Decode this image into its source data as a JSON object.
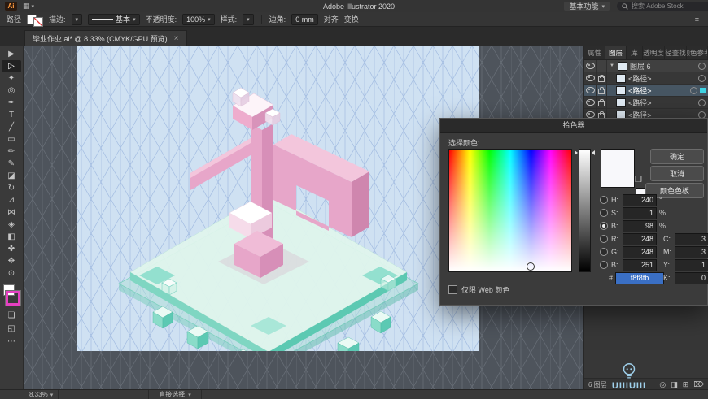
{
  "titlebar": {
    "logo": "Ai",
    "arrange_icon": "▦",
    "title": "Adobe Illustrator 2020",
    "workspace": "基本功能",
    "search_placeholder": "搜索 Adobe Stock",
    "caret": "▾"
  },
  "controlbar": {
    "context": "路径",
    "stroke": "描边:",
    "brush": "基本",
    "opacity": "不透明度:",
    "opacity_value": "100%",
    "style": "样式:",
    "corner": "边角:",
    "corner_value": "0 mm",
    "align": "对齐",
    "transform": "变换",
    "menu_icon": "≡",
    "more_icon": "⋯",
    "caret": "▾"
  },
  "doc_tab": {
    "title": "毕业作业.ai* @ 8.33% (CMYK/GPU 预览)",
    "close": "×"
  },
  "tools": [
    {
      "name": "selection-tool",
      "glyph": "▶"
    },
    {
      "name": "direct-selection-tool",
      "glyph": "▷",
      "active": true
    },
    {
      "name": "magic-wand-tool",
      "glyph": "✦"
    },
    {
      "name": "lasso-tool",
      "glyph": "◎"
    },
    {
      "name": "pen-tool",
      "glyph": "✒"
    },
    {
      "name": "type-tool",
      "glyph": "T"
    },
    {
      "name": "line-segment-tool",
      "glyph": "╱"
    },
    {
      "name": "rectangle-tool",
      "glyph": "▭"
    },
    {
      "name": "paintbrush-tool",
      "glyph": "✏"
    },
    {
      "name": "pencil-tool",
      "glyph": "✎"
    },
    {
      "name": "eraser-tool",
      "glyph": "◪"
    },
    {
      "name": "rotate-tool",
      "glyph": "↻"
    },
    {
      "name": "scale-tool",
      "glyph": "⊿"
    },
    {
      "name": "width-tool",
      "glyph": "⋈"
    },
    {
      "name": "shape-builder-tool",
      "glyph": "◈"
    },
    {
      "name": "gradient-tool",
      "glyph": "◧"
    },
    {
      "name": "eyedropper-tool",
      "glyph": "✤"
    },
    {
      "name": "hand-tool",
      "glyph": "✥"
    },
    {
      "name": "zoom-tool",
      "glyph": "⊙"
    }
  ],
  "toolbar_bottom": [
    {
      "name": "draw-mode-icon",
      "glyph": "❏"
    },
    {
      "name": "screen-mode-icon",
      "glyph": "◱"
    },
    {
      "name": "edit-toolbar-icon",
      "glyph": "⋯"
    }
  ],
  "color_picker": {
    "title": "拾色器",
    "select_color_label": "选择颜色:",
    "ok": "确定",
    "cancel": "取消",
    "swatches_button": "颜色色板",
    "web_only": "仅限 Web 颜色",
    "gamut_icon": "❒",
    "hsb": [
      {
        "label": "H:",
        "value": "240",
        "unit": "°",
        "selected": false
      },
      {
        "label": "S:",
        "value": "1",
        "unit": "%",
        "selected": false
      },
      {
        "label": "B:",
        "value": "98",
        "unit": "%",
        "selected": true
      }
    ],
    "rgb": [
      {
        "label": "R:",
        "value": "248",
        "selected": false
      },
      {
        "label": "G:",
        "value": "248",
        "selected": false
      },
      {
        "label": "B:",
        "value": "251",
        "selected": false
      }
    ],
    "hex_label": "#",
    "hex": "f8f8fb",
    "cmyk": [
      {
        "label": "C:",
        "value": "3",
        "unit": "%"
      },
      {
        "label": "M:",
        "value": "3",
        "unit": "%"
      },
      {
        "label": "Y:",
        "value": "1",
        "unit": "%"
      },
      {
        "label": "K:",
        "value": "0",
        "unit": "%"
      }
    ]
  },
  "right_dock": {
    "tab_groups": [
      {
        "tabs": [
          {
            "label": "属性"
          },
          {
            "label": "图层",
            "active": true
          },
          {
            "label": "库"
          }
        ]
      },
      {
        "tabs": [
          {
            "label": "透明度"
          },
          {
            "label": "路径查找器"
          },
          {
            "label": "颜色参考"
          }
        ]
      }
    ],
    "layers_panel": {
      "rows": [
        {
          "label": "图层 6",
          "kind": "layer",
          "eye": true,
          "lock": false,
          "selected": false
        },
        {
          "label": "<路径>",
          "kind": "path",
          "eye": true,
          "lock": true,
          "selected": false
        },
        {
          "label": "<路径>",
          "kind": "path",
          "eye": true,
          "lock": true,
          "selected": true
        },
        {
          "label": "<路径>",
          "kind": "path",
          "eye": true,
          "lock": true,
          "selected": false
        },
        {
          "label": "<路径>",
          "kind": "path",
          "eye": true,
          "lock": true,
          "selected": false
        },
        {
          "label": "<路径>",
          "kind": "path",
          "eye": true,
          "lock": true,
          "selected": false
        }
      ],
      "footer_count": "6 图层",
      "footer_icons": [
        {
          "name": "locate-object",
          "glyph": "◎"
        },
        {
          "name": "make-clip-mask",
          "glyph": "◨"
        },
        {
          "name": "new-layer",
          "glyph": "⊞"
        },
        {
          "name": "delete-layer",
          "glyph": "⌦"
        }
      ]
    }
  },
  "statusbar": {
    "zoom": "8.33%",
    "tool": "直接选择",
    "caret": "▾"
  },
  "watermark": {
    "text": "UIIIUIII"
  },
  "colors": {
    "accent_blue": "#3a6fc4",
    "layer_selection_cyan": "#3fd4e4",
    "stroke_magenta": "#e540c1",
    "artboard_blue": "#cfe1f2",
    "platform_mint": "#84d8c5",
    "glyph_pink": "#e7a6c9",
    "current_color": "#f8f8fb"
  }
}
